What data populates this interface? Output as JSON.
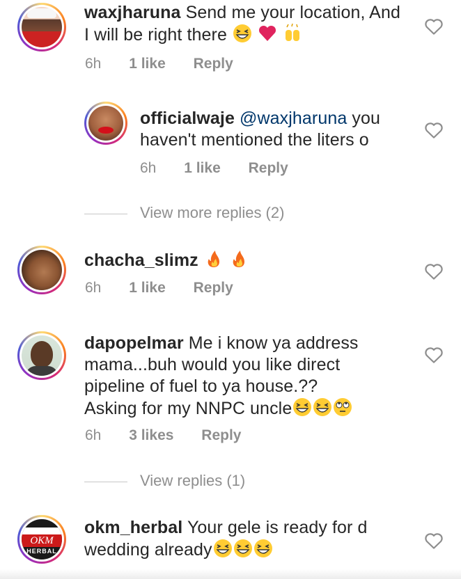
{
  "comments": [
    {
      "username": "waxjharuna",
      "text_line1": "Send me your location, And",
      "text_line2": "I will be right there",
      "emojis": [
        "grinning-squint-emoji",
        "heart-emoji",
        "raised-hands-emoji"
      ],
      "time": "6h",
      "likes": "1 like",
      "reply": "Reply"
    },
    {
      "username": "officialwaje",
      "mention": "@waxjharuna",
      "text_line1_rest": "you",
      "text_line2": "haven't mentioned the liters o",
      "time": "6h",
      "likes": "1 like",
      "reply": "Reply"
    },
    {
      "username": "chacha_slimz",
      "emojis": [
        "fire-emoji",
        "fire-emoji"
      ],
      "time": "6h",
      "likes": "1 like",
      "reply": "Reply"
    },
    {
      "username": "dapopelmar",
      "text_line1": "Me i know ya address",
      "text_line2": "mama...buh would you like direct",
      "text_line3": "pipeline of fuel to ya house.??",
      "text_line4": "Asking for my NNPC uncle",
      "emojis": [
        "grinning-squint-emoji",
        "grinning-squint-emoji",
        "eye-roll-emoji"
      ],
      "time": "6h",
      "likes": "3 likes",
      "reply": "Reply"
    },
    {
      "username": "okm_herbal",
      "text_line1": "Your gele is ready for d",
      "text_line2": "wedding already",
      "emojis": [
        "grinning-squint-emoji",
        "grinning-squint-emoji",
        "grinning-squint-emoji"
      ],
      "avatar_text_top": "OKM",
      "avatar_text_bottom": "HERBAL"
    }
  ],
  "view_more_1": "View more replies (2)",
  "view_more_2": "View replies (1)",
  "colors": {
    "text": "#262626",
    "meta": "#8e8e8e",
    "mention": "#00376b",
    "heart_emoji": "#e0245e"
  }
}
